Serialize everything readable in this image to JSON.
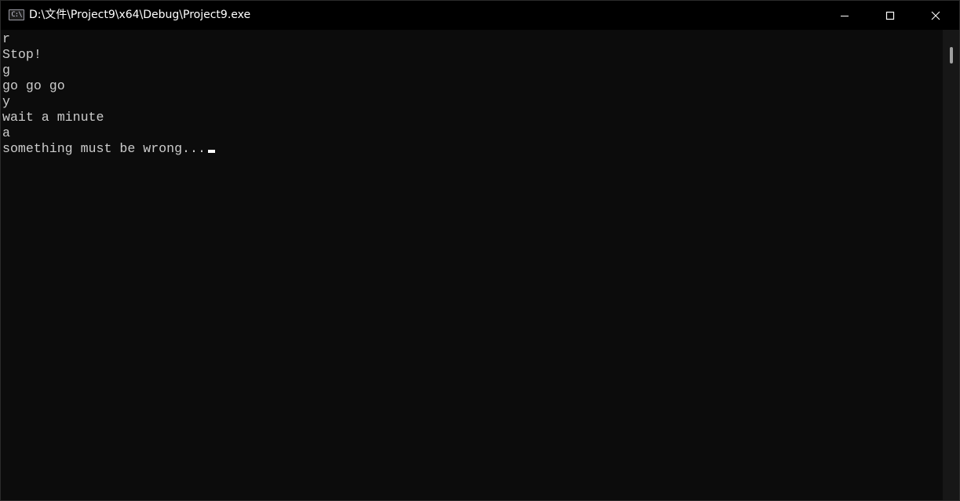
{
  "window": {
    "title": "D:\\文件\\Project9\\x64\\Debug\\Project9.exe",
    "icon": "console-app-icon",
    "icon_glyph": "C:\\",
    "controls": {
      "minimize": "minimize-icon",
      "maximize": "maximize-icon",
      "close": "close-icon"
    }
  },
  "console": {
    "lines": [
      "r",
      "Stop!",
      "g",
      "go go go",
      "y",
      "wait a minute",
      "a",
      "something must be wrong..."
    ],
    "colors": {
      "background": "#0c0c0c",
      "foreground": "#cccccc",
      "cursor": "#ffffff"
    }
  }
}
